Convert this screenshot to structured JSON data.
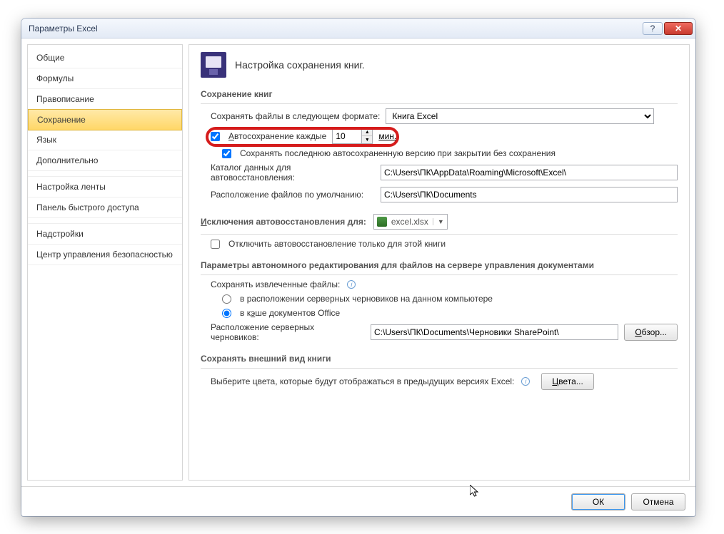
{
  "window": {
    "title": "Параметры Excel"
  },
  "sidebar": {
    "items": [
      {
        "label": "Общие"
      },
      {
        "label": "Формулы"
      },
      {
        "label": "Правописание"
      },
      {
        "label": "Сохранение",
        "selected": true
      },
      {
        "label": "Язык"
      },
      {
        "label": "Дополнительно"
      },
      {
        "label": "Настройка ленты"
      },
      {
        "label": "Панель быстрого доступа"
      },
      {
        "label": "Надстройки"
      },
      {
        "label": "Центр управления безопасностью"
      }
    ]
  },
  "header": {
    "title": "Настройка сохранения книг."
  },
  "sections": {
    "save_books": {
      "title": "Сохранение книг",
      "format_label": "Сохранять файлы в следующем формате:",
      "format_value": "Книга Excel",
      "autosave_checked": true,
      "autosave_pre": "А",
      "autosave_rest": "втосохранение каждые",
      "autosave_value": "10",
      "autosave_unit": "мин.",
      "keep_last_checked": true,
      "keep_last_label": "Сохранять последнюю автосохраненную версию при закрытии без сохранения",
      "autorecover_dir_label": "Каталог данных для автовосстановления:",
      "autorecover_dir_value": "C:\\Users\\ПК\\AppData\\Roaming\\Microsoft\\Excel\\",
      "default_dir_label": "Расположение файлов по умолчанию:",
      "default_dir_value": "C:\\Users\\ПК\\Documents"
    },
    "exceptions": {
      "title_pre": "И",
      "title_rest": "сключения автовосстановления для:",
      "file": "excel.xlsx",
      "disable_checked": false,
      "disable_label": "Отключить автовосстановление только для этой книги"
    },
    "offline": {
      "title": "Параметры автономного редактирования для файлов на сервере управления документами",
      "save_checked_label": "Сохранять извлеченные файлы:",
      "opt_server": "в расположении серверных черновиков на данном компьютере",
      "opt_cache_pre": "в к",
      "opt_cache_u": "э",
      "opt_cache_post": "ше документов Office",
      "server_drafts_label": "Расположение серверных черновиков:",
      "server_drafts_value": "C:\\Users\\ПК\\Documents\\Черновики SharePoint\\",
      "browse": "Обзор..."
    },
    "appearance": {
      "title": "Сохранять внешний вид книги",
      "choose_colors_label": "Выберите цвета, которые будут отображаться в предыдущих версиях Excel:",
      "colors_btn_pre": "Ц",
      "colors_btn_rest": "вета..."
    }
  },
  "footer": {
    "ok": "ОК",
    "cancel": "Отмена"
  }
}
